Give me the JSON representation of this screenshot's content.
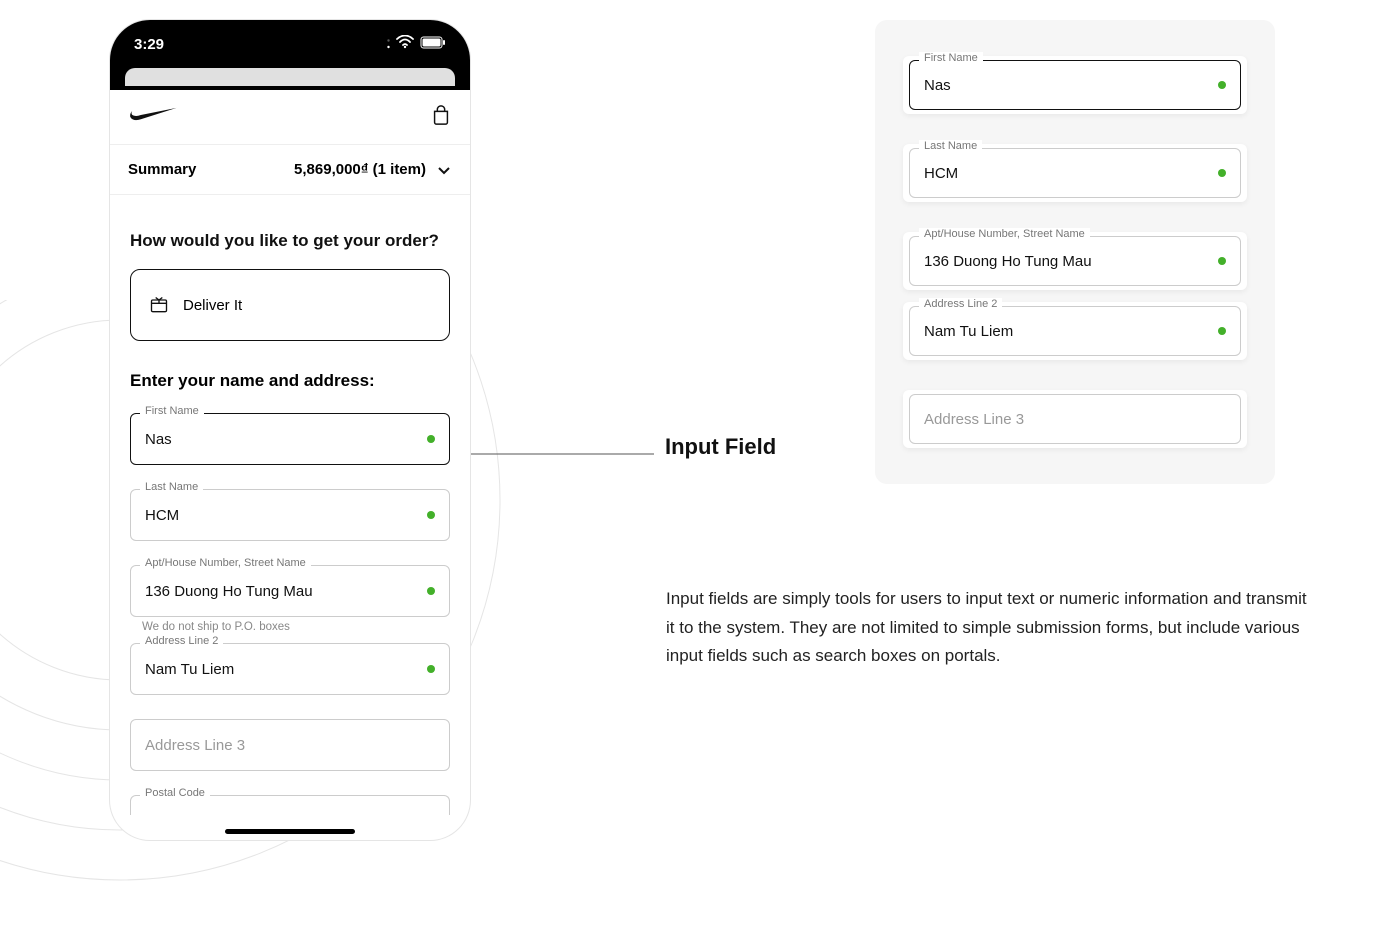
{
  "phone": {
    "status_time": "3:29",
    "brand": "nike-swoosh",
    "bag_icon": "bag-icon",
    "summary": {
      "label": "Summary",
      "total": "5,869,000₫ (1 item)"
    },
    "delivery_question": "How would you like to get your order?",
    "deliver_option": "Deliver It",
    "form_title": "Enter your name and address:",
    "fields": {
      "first_name": {
        "label": "First Name",
        "value": "Nas"
      },
      "last_name": {
        "label": "Last Name",
        "value": "HCM"
      },
      "street": {
        "label": "Apt/House Number, Street Name",
        "value": "136 Duong Ho Tung Mau"
      },
      "street_hint": "We do not ship to P.O. boxes",
      "address2": {
        "label": "Address Line 2",
        "value": "Nam Tu Liem"
      },
      "address3": {
        "placeholder": "Address Line 3"
      },
      "postal": {
        "label": "Postal Code"
      }
    }
  },
  "annotation": {
    "label": "Input Field"
  },
  "right_panel": {
    "fields": {
      "first_name": {
        "label": "First Name",
        "value": "Nas"
      },
      "last_name": {
        "label": "Last Name",
        "value": "HCM"
      },
      "street": {
        "label": "Apt/House Number, Street Name",
        "value": "136 Duong Ho Tung Mau"
      },
      "address2": {
        "label": "Address Line 2",
        "value": "Nam Tu Liem"
      },
      "address3": {
        "placeholder": "Address Line 3"
      }
    }
  },
  "description": "Input fields are simply tools for users to input text or numeric information and transmit it to the system. They are not limited to simple submission forms, but include various input fields such as search boxes on portals."
}
